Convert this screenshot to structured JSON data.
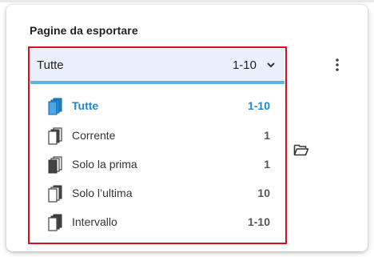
{
  "section": {
    "title": "Pagine da esportare"
  },
  "select": {
    "label": "Tutte",
    "range": "1-10"
  },
  "options": [
    {
      "label": "Tutte",
      "count": "1-10",
      "icon": "pages-all-icon"
    },
    {
      "label": "Corrente",
      "count": "1",
      "icon": "page-current-icon"
    },
    {
      "label": "Solo la prima",
      "count": "1",
      "icon": "page-first-icon"
    },
    {
      "label": "Solo l’ultima",
      "count": "10",
      "icon": "page-last-icon"
    },
    {
      "label": "Intervallo",
      "count": "1-10",
      "icon": "page-range-icon"
    }
  ],
  "colors": {
    "accent": "#1e88d8",
    "highlight_frame": "#d80f1f",
    "select_bg": "#e9f0fb",
    "select_underline": "#5ab4e6"
  },
  "icons": {
    "more": "more-vert-icon",
    "folder": "folder-open-icon",
    "chevron": "chevron-down-icon"
  }
}
